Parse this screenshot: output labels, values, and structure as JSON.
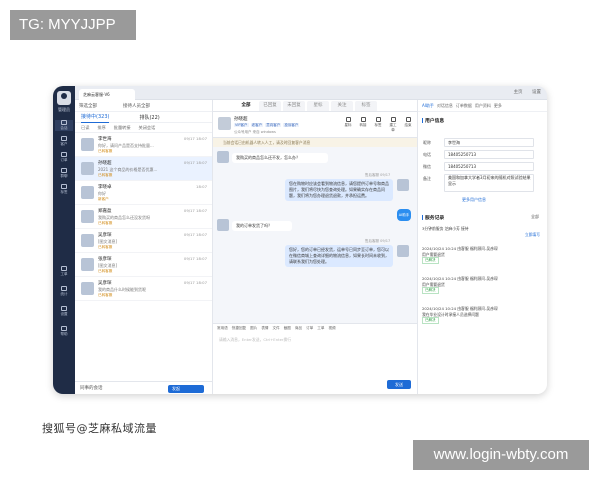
{
  "watermark_top": "TG: MYYJJPP",
  "watermark_bottom": "www.login-wbty.com",
  "caption": "搜狐号@芝麻私域流量",
  "app": {
    "nav": {
      "user": "管理员",
      "items": [
        "会话",
        "客户",
        "订单",
        "群聊",
        "标签",
        "工单",
        "统计",
        "设置",
        "帮助"
      ]
    },
    "topbar": {
      "tab": "芝麻云客服-V6",
      "links": [
        "主页",
        "设置"
      ]
    },
    "list": {
      "filters": [
        "筛选全部",
        "接待人员全部"
      ],
      "tabs": [
        "接待中(323)",
        "排队(22)"
      ],
      "ops": [
        "已读",
        "排序",
        "批量转接",
        "关闭会话"
      ],
      "conversations": [
        {
          "name": "李世海",
          "time": "09/17 18:07",
          "msg": "你好，请问产品是否支持批量...",
          "tag": "已转客服"
        },
        {
          "name": "孙晓超",
          "time": "09/17 18:07",
          "msg": "2021 这个商品的价格是否优惠...",
          "tag": "已转客服",
          "selected": true
        },
        {
          "name": "李晓卓",
          "time": "18:07",
          "msg": "你好",
          "tag": "新客户"
        },
        {
          "name": "郑嘉盈",
          "time": "09/17 18:07",
          "msg": "我购买的商品怎么还没发货呀",
          "tag": "已转客服"
        },
        {
          "name": "吴彦琛",
          "time": "09/17 18:07",
          "msg": "[图文消息]",
          "tag": "已转客服"
        },
        {
          "name": "张彦琛",
          "time": "09/17 18:07",
          "msg": "[图文消息]",
          "tag": "已转客服"
        },
        {
          "name": "吴彦琛",
          "time": "09/17 18:07",
          "msg": "我的商品什么时候能到货呢",
          "tag": "已转客服"
        }
      ],
      "footer_left": "同事的会话",
      "footer_button": "发起"
    },
    "chat": {
      "tabs": [
        "全部",
        "已回复",
        "未回复",
        "星标",
        "关注",
        "标签"
      ],
      "customer": {
        "name": "孙晓超",
        "chips": [
          "VIP客户",
          "老客户",
          "意向客户",
          "投诉客户"
        ],
        "meta": "公众号用户 来自 windows",
        "actions": [
          "星标",
          "转接",
          "标签",
          "建工单",
          "结束"
        ]
      },
      "notice": "当前会话已由机器人转入人工，请及时回复客户消息",
      "messages": [
        {
          "dir": "in",
          "text": "我购买的商品怎么还不发，怎么办？",
          "time": ""
        },
        {
          "dir": "out",
          "sender": "售后客服 09/17",
          "text": "您在购物时应该会看到物流信息，请您提供订单号和商品图片，我们将尽快为您查询处理。如果确实存在商品问题，我们将为您办理退货退款，并承担运费。"
        },
        {
          "dir": "in",
          "text": "我的订单发货了吗？",
          "time": ""
        },
        {
          "dir": "out",
          "sender": "售后客服 09/17",
          "text": "您好，您的订单已经发货，运单号已同步至订单，您可以在微信商城上查询详细的物流信息，如果长时间未收到，请联系我们为您处理。"
        }
      ],
      "bot_label": "AI助手",
      "tools": [
        "常用语",
        "快捷回复",
        "图片",
        "表情",
        "文件",
        "截图",
        "商品",
        "订单",
        "工单",
        "视频"
      ],
      "placeholder": "请输入消息，Enter发送，Ctrl+Enter换行",
      "send_label": "发送"
    },
    "panel": {
      "tabs": [
        "AI助手",
        "对话信息",
        "订单数据",
        "用户资料",
        "更多"
      ],
      "user_info_title": "用户信息",
      "fields": [
        {
          "label": "昵称",
          "value": "李世海"
        },
        {
          "label": "电话",
          "value": "18405250713"
        },
        {
          "label": "微信",
          "value": "18405250713"
        },
        {
          "label": "备注",
          "value": "美国和加拿大学者3月初来的随机对照试验结果显示"
        }
      ],
      "more_label": "更多用户信息",
      "service_title": "服务记录",
      "service_filter": "全部",
      "service_sub": "3分钟前服务 芝麻小芳 接待",
      "service_link": "立即填写",
      "records": [
        {
          "time": "2024/10/24 10:24",
          "who": "由客服 福利顾问-吴彦琛",
          "desc": "用户需要退货",
          "status": "已解决"
        },
        {
          "time": "2024/10/24 10:24",
          "who": "由客服 福利顾问-吴彦琛",
          "desc": "用户需要退货",
          "status": "已解决"
        },
        {
          "time": "2024/10/24 10:24",
          "who": "由客服 福利顾问-吴彦琛",
          "desc": "我在毕业设计时承接人员选择问题",
          "status": "已解决"
        }
      ]
    }
  }
}
